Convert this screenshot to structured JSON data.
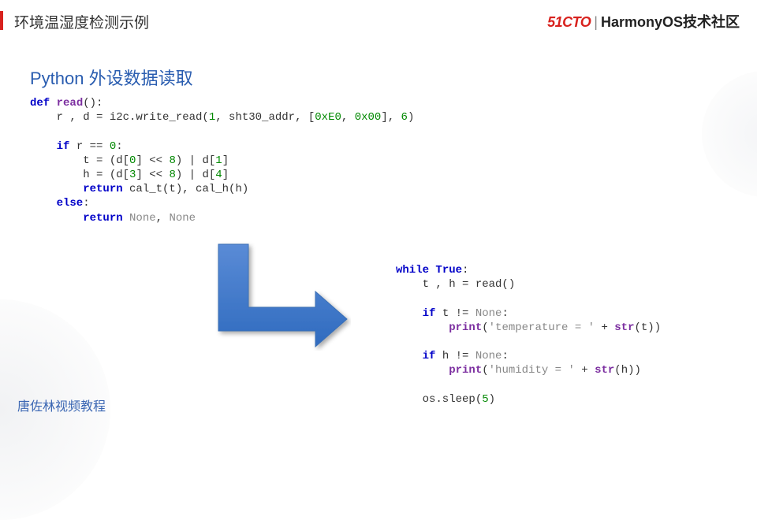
{
  "header": {
    "title_left": "环境温湿度检测示例",
    "brand_red": "51CTO",
    "brand_sep": "|",
    "brand_text": "HarmonyOS技术社区"
  },
  "section": {
    "title": "Python 外设数据读取"
  },
  "code_left": {
    "l1_def": "def",
    "l1_fn": " read",
    "l1_rest": "():",
    "l2a": "    r , d = i2c.write_read(",
    "l2n1": "1",
    "l2b": ", sht30_addr, [",
    "l2n2": "0xE0",
    "l2c": ", ",
    "l2n3": "0x00",
    "l2d": "], ",
    "l2n4": "6",
    "l2e": ")",
    "l4_if": "    if",
    "l4_rest": " r == ",
    "l4_n": "0",
    "l4_colon": ":",
    "l5a": "        t = (d[",
    "l5n1": "0",
    "l5b": "] << ",
    "l5n2": "8",
    "l5c": ") | d[",
    "l5n3": "1",
    "l5d": "]",
    "l6a": "        h = (d[",
    "l6n1": "3",
    "l6b": "] << ",
    "l6n2": "8",
    "l6c": ") | d[",
    "l6n3": "4",
    "l6d": "]",
    "l7_ret": "        return",
    "l7_rest": " cal_t(t), cal_h(h)",
    "l8_else": "    else",
    "l8_colon": ":",
    "l9_ret": "        return",
    "l9_sp": " ",
    "l9_none1": "None",
    "l9_comma": ", ",
    "l9_none2": "None"
  },
  "code_right": {
    "l1_while": "while",
    "l1_sp": " ",
    "l1_true": "True",
    "l1_colon": ":",
    "l2": "    t , h = read()",
    "l4_if": "    if",
    "l4_rest": " t != ",
    "l4_none": "None",
    "l4_colon": ":",
    "l5_pad": "        ",
    "l5_print": "print",
    "l5_open": "(",
    "l5_str": "'temperature = '",
    "l5_plus": " + ",
    "l5_strfn": "str",
    "l5_close": "(t))",
    "l7_if": "    if",
    "l7_rest": " h != ",
    "l7_none": "None",
    "l7_colon": ":",
    "l8_pad": "        ",
    "l8_print": "print",
    "l8_open": "(",
    "l8_str": "'humidity = '",
    "l8_plus": " + ",
    "l8_strfn": "str",
    "l8_close": "(h))",
    "l10a": "    os.sleep(",
    "l10n": "5",
    "l10b": ")"
  },
  "footer": {
    "text": "唐佐林视频教程"
  }
}
